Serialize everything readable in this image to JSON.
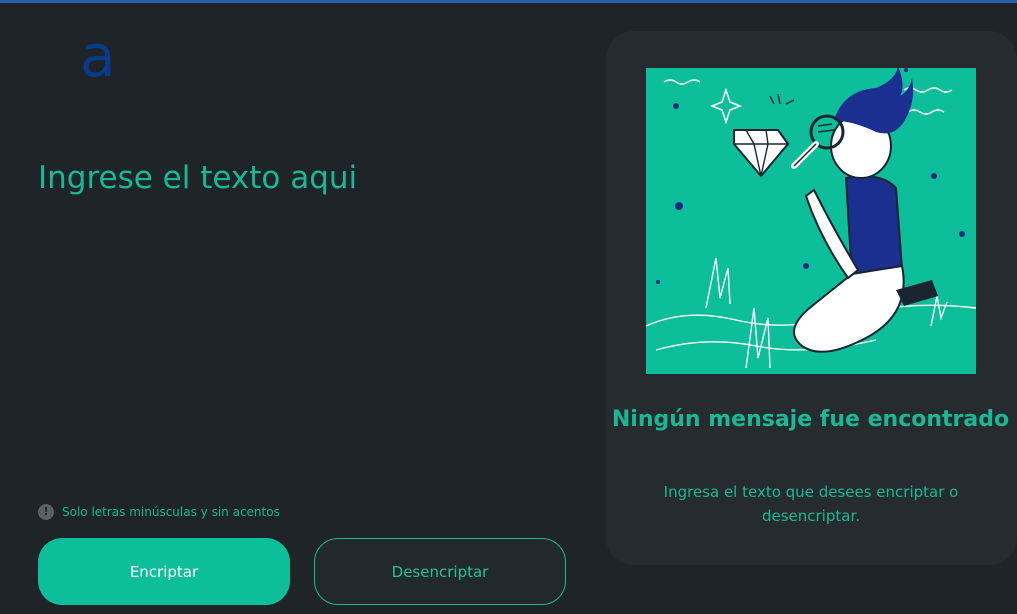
{
  "logo": {
    "letter": "a",
    "color": "#0a3a8a"
  },
  "input": {
    "placeholder": "Ingrese el texto aqui"
  },
  "hint": {
    "icon": "exclamation-circle-icon",
    "text": "Solo letras minúsculas y sin acentos"
  },
  "buttons": {
    "encrypt_label": "Encriptar",
    "decrypt_label": "Desencriptar"
  },
  "output_panel": {
    "illustration": "person-with-magnifying-glass-inspecting-diamond",
    "title": "Ningún mensaje fue encontrado",
    "description": "Ingresa el texto que desees encriptar o desencriptar."
  },
  "colors": {
    "background": "#1e2428",
    "accent": "#0cbf9a",
    "panel": "#262b2f",
    "illustration_bg": "#0cbf9a",
    "navy": "#0b2a7a"
  }
}
